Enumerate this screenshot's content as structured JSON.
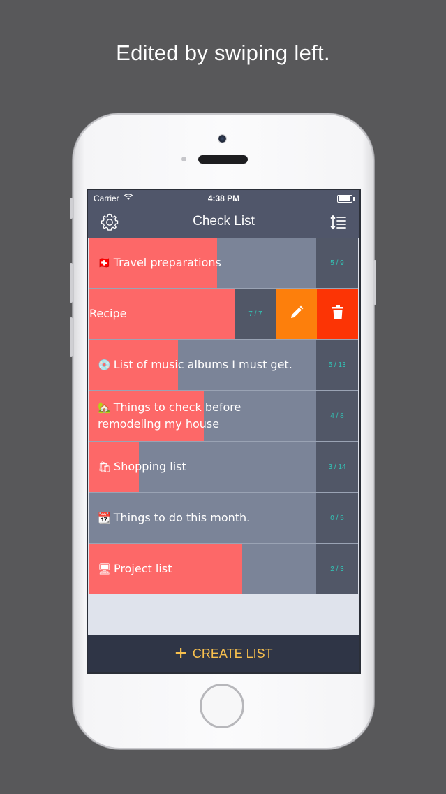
{
  "caption": "Edited by swiping left.",
  "status_bar": {
    "carrier": "Carrier",
    "time": "4:38 PM"
  },
  "nav": {
    "title": "Check List"
  },
  "lists": [
    {
      "emoji": "🇨🇭",
      "title": "Travel preparations",
      "count": "5 / 9",
      "progress": 0.56
    },
    {
      "emoji": "",
      "title": "Recipe",
      "count": "7 / 7",
      "progress": 1.0,
      "swiped": true
    },
    {
      "emoji": "💿",
      "title": "List of music albums I must get.",
      "count": "5 / 13",
      "progress": 0.38
    },
    {
      "emoji": "🏡",
      "title": "Things to check before remodeling my house",
      "count": "4 / 8",
      "progress": 0.5
    },
    {
      "emoji": "🛍",
      "title": "Shopping list",
      "count": "3 / 14",
      "progress": 0.21
    },
    {
      "emoji": "📆",
      "title": "Things to do this month.",
      "count": "0 / 5",
      "progress": 0.0
    },
    {
      "emoji": "🖥",
      "title": "Project list",
      "count": "2 / 3",
      "progress": 0.67
    }
  ],
  "footer": {
    "plus": "+",
    "create_label": "CREATE LIST"
  },
  "colors": {
    "progress": "#fd6868",
    "edit": "#fd7f0c",
    "delete": "#fc3405",
    "count": "#31c7b8",
    "accent": "#f8c04e"
  },
  "icons": {
    "settings": "gear-icon",
    "sort": "sort-icon",
    "edit": "pencil-icon",
    "delete": "trash-icon"
  }
}
